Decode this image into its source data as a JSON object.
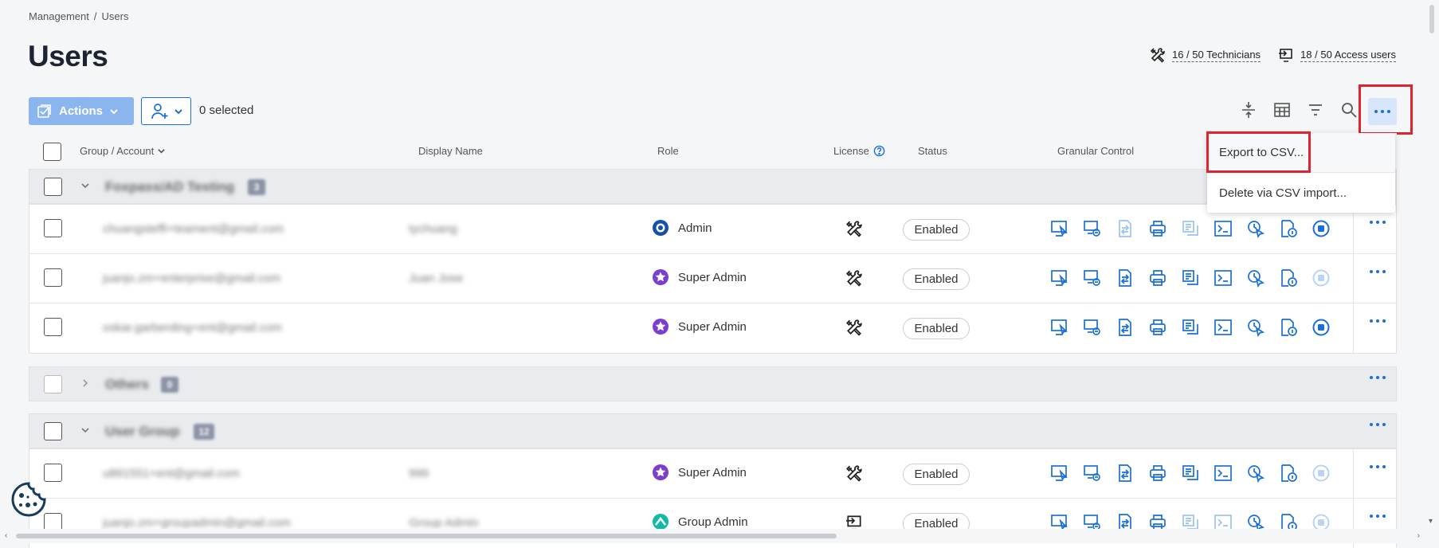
{
  "breadcrumb": {
    "parent": "Management",
    "separator": "/",
    "current": "Users"
  },
  "page_title": "Users",
  "counts": {
    "technicians": "16 / 50 Technicians",
    "access_users": "18 / 50 Access users"
  },
  "toolbar": {
    "actions_label": "Actions",
    "selected_text": "0 selected"
  },
  "table": {
    "columns": {
      "group_account": "Group / Account",
      "display_name": "Display Name",
      "role": "Role",
      "license": "License",
      "status": "Status",
      "granular_control": "Granular Control"
    },
    "groups": [
      {
        "name": "Foxpass/AD Testing",
        "count": "3"
      },
      {
        "name": "Others",
        "count": "0"
      },
      {
        "name": "User Group",
        "count": "12"
      }
    ],
    "rows": [
      {
        "email": "chuangsteffi+teament@gmail.com",
        "display": "tychuang",
        "role": "Admin",
        "status": "Enabled"
      },
      {
        "email": "juanjo.zm+enterprise@gmail.com",
        "display": "Juan Jose",
        "role": "Super Admin",
        "status": "Enabled"
      },
      {
        "email": "oskar.garberding+ent@gmail.com",
        "display": "",
        "role": "Super Admin",
        "status": "Enabled"
      },
      {
        "email": "u891551+ent@gmail.com",
        "display": "999",
        "role": "Super Admin",
        "status": "Enabled"
      },
      {
        "email": "juanjo.zm+groupadmin@gmail.com",
        "display": "Group Admin",
        "role": "Group Admin",
        "status": "Enabled"
      }
    ]
  },
  "menu": {
    "export_csv": "Export to CSV...",
    "delete_csv": "Delete via CSV import..."
  },
  "colors": {
    "accent": "#1a6fd8",
    "highlight": "#e0242f",
    "admin": "#1550b0",
    "super_admin": "#7b3fd0",
    "group_admin": "#14b8a6"
  }
}
